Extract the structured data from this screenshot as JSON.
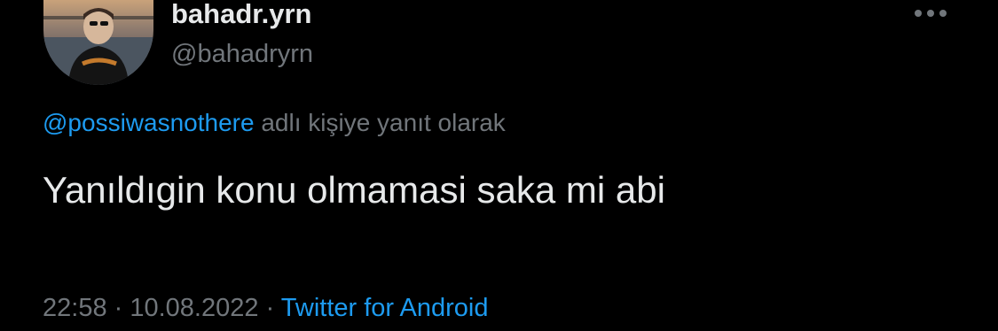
{
  "author": {
    "display_name": "bahadr.yrn",
    "handle": "@bahadryrn"
  },
  "reply_context": {
    "mention": "@possiwasnothere",
    "suffix": " adlı kişiye yanıt olarak"
  },
  "tweet": {
    "text": "Yanıldıgin konu olmamasi saka mi abi"
  },
  "meta": {
    "time": "22:58",
    "separator_1": " · ",
    "date": "10.08.2022",
    "separator_2": " · ",
    "source": "Twitter for Android"
  },
  "icons": {
    "more": "more-horizontal-icon"
  },
  "colors": {
    "background": "#000000",
    "primary_text": "#e7e9ea",
    "secondary_text": "#71767b",
    "accent": "#1d9bf0"
  }
}
